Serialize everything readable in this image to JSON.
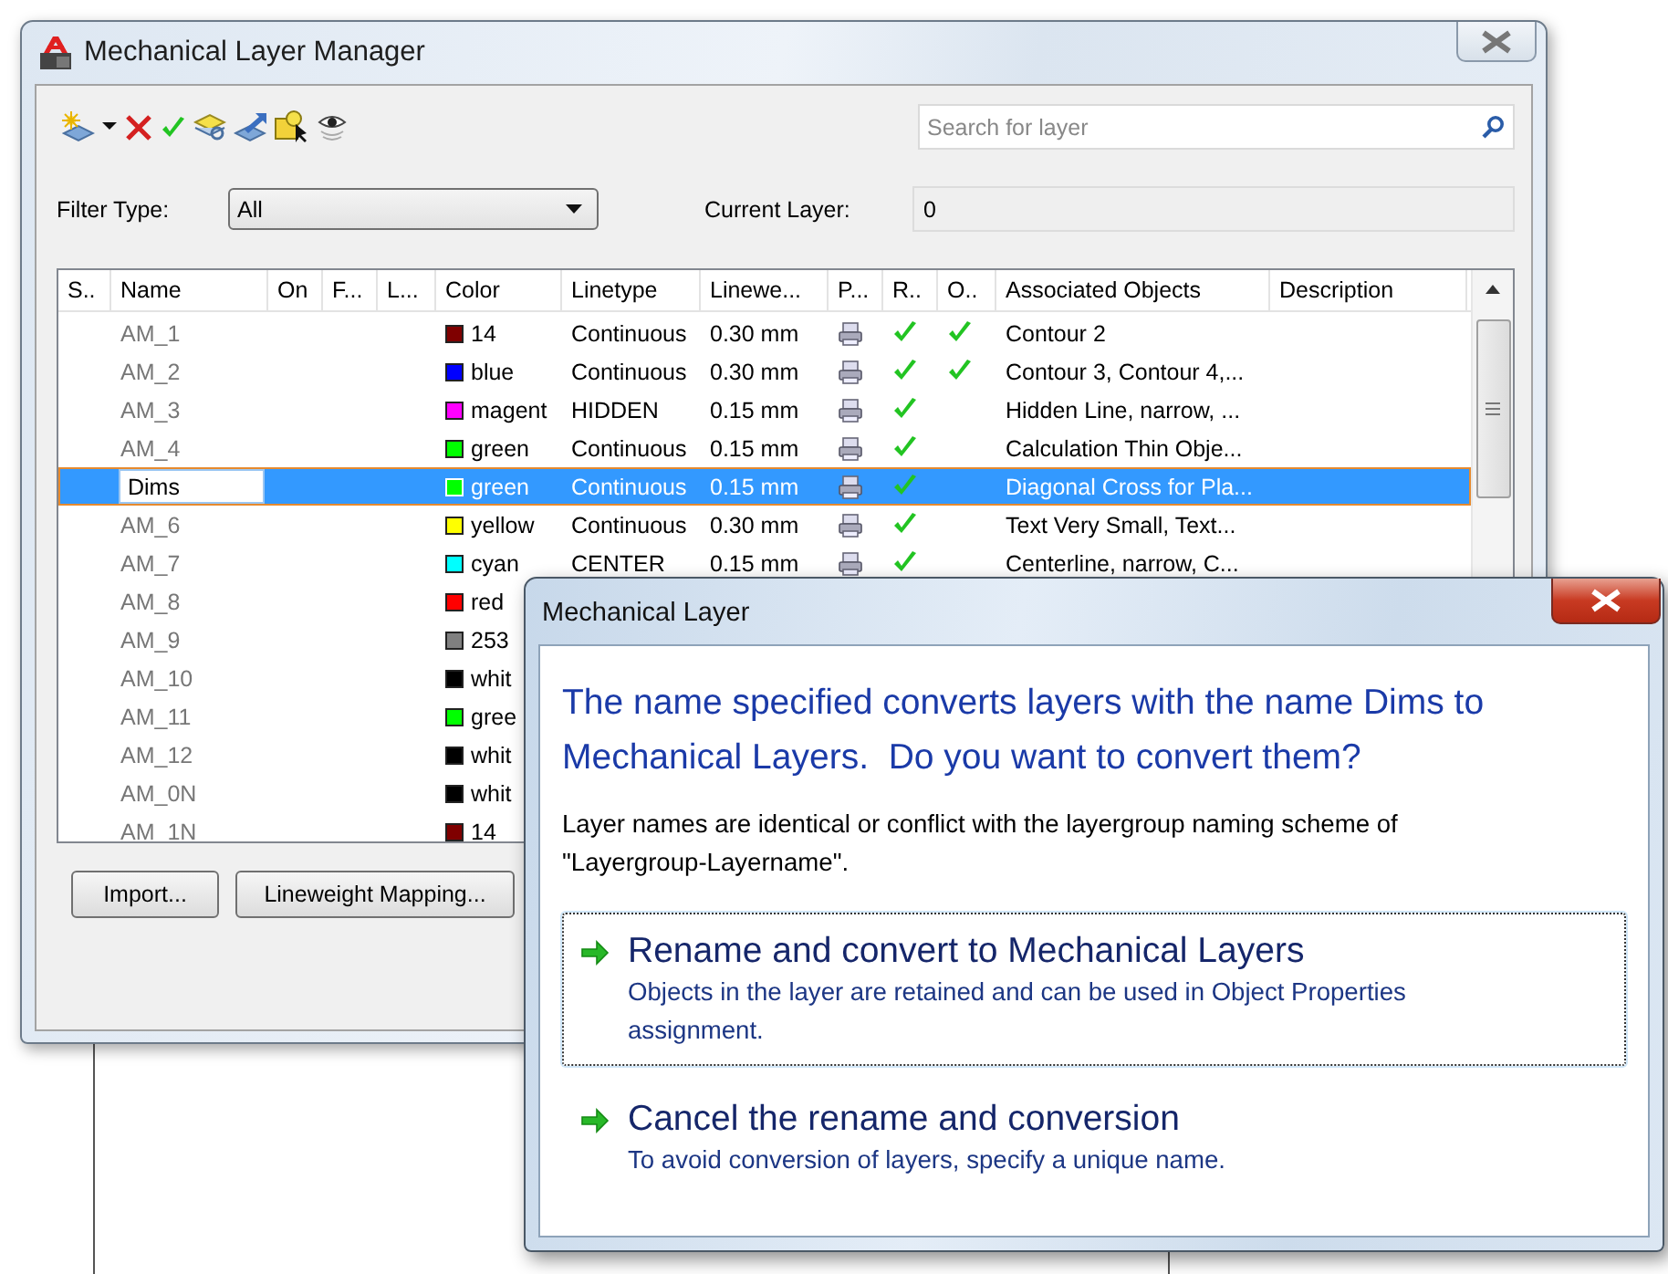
{
  "main_window": {
    "title": "Mechanical Layer Manager",
    "search": {
      "placeholder": "Search for layer"
    },
    "filter_type": {
      "label": "Filter Type:",
      "value": "All"
    },
    "current_layer": {
      "label": "Current Layer:",
      "value": "0"
    },
    "table": {
      "columns": [
        "S..",
        "Name",
        "On",
        "F...",
        "L...",
        "Color",
        "Linetype",
        "Linewe...",
        "P...",
        "R..",
        "O..",
        "Associated Objects",
        "Description"
      ],
      "rows": [
        {
          "name": "AM_1",
          "color": "#7f0000",
          "color_name": "14",
          "linetype": "Continuous",
          "lineweight": "0.30 mm",
          "plot": true,
          "r_check": true,
          "o_check": true,
          "associated": "Contour 2",
          "selected": false,
          "editing": false
        },
        {
          "name": "AM_2",
          "color": "#0000ff",
          "color_name": "blue",
          "linetype": "Continuous",
          "lineweight": "0.30 mm",
          "plot": true,
          "r_check": true,
          "o_check": true,
          "associated": "Contour 3, Contour 4,...",
          "selected": false,
          "editing": false
        },
        {
          "name": "AM_3",
          "color": "#ff00ff",
          "color_name": "magent",
          "linetype": "HIDDEN",
          "lineweight": "0.15 mm",
          "plot": true,
          "r_check": true,
          "o_check": false,
          "associated": "Hidden Line, narrow, ...",
          "selected": false,
          "editing": false
        },
        {
          "name": "AM_4",
          "color": "#00ff00",
          "color_name": "green",
          "linetype": "Continuous",
          "lineweight": "0.15 mm",
          "plot": true,
          "r_check": true,
          "o_check": false,
          "associated": "Calculation Thin Obje...",
          "selected": false,
          "editing": false
        },
        {
          "name": "Dims",
          "color": "#00ff00",
          "color_name": "green",
          "linetype": "Continuous",
          "lineweight": "0.15 mm",
          "plot": true,
          "r_check": true,
          "o_check": false,
          "associated": "Diagonal Cross for Pla...",
          "selected": true,
          "editing": true
        },
        {
          "name": "AM_6",
          "color": "#ffff00",
          "color_name": "yellow",
          "linetype": "Continuous",
          "lineweight": "0.30 mm",
          "plot": true,
          "r_check": true,
          "o_check": false,
          "associated": "Text Very Small, Text...",
          "selected": false,
          "editing": false
        },
        {
          "name": "AM_7",
          "color": "#00ffff",
          "color_name": "cyan",
          "linetype": "CENTER",
          "lineweight": "0.15 mm",
          "plot": true,
          "r_check": true,
          "o_check": false,
          "associated": "Centerline, narrow, C...",
          "selected": false,
          "editing": false
        },
        {
          "name": "AM_8",
          "color": "#ff0000",
          "color_name": "red",
          "selected": false,
          "editing": false
        },
        {
          "name": "AM_9",
          "color": "#808080",
          "color_name": "253",
          "selected": false,
          "editing": false
        },
        {
          "name": "AM_10",
          "color": "#000000",
          "color_name": "whit",
          "selected": false,
          "editing": false
        },
        {
          "name": "AM_11",
          "color": "#00ff00",
          "color_name": "gree",
          "selected": false,
          "editing": false
        },
        {
          "name": "AM_12",
          "color": "#000000",
          "color_name": "whit",
          "selected": false,
          "editing": false
        },
        {
          "name": "AM_0N",
          "color": "#000000",
          "color_name": "whit",
          "selected": false,
          "editing": false
        },
        {
          "name": "AM_1N",
          "color": "#7f0000",
          "color_name": "14",
          "selected": false,
          "editing": false
        }
      ]
    },
    "buttons": [
      "Import...",
      "Lineweight Mapping..."
    ]
  },
  "dialog": {
    "title": "Mechanical Layer",
    "heading": "The name specified converts layers with the name Dims to Mechanical Layers.  Do you want to convert them?",
    "body": "Layer names are identical or conflict with the layergroup naming scheme of \"Layergroup-Layername\".",
    "options": [
      {
        "title": "Rename and convert to Mechanical Layers",
        "description": "Objects in the layer are retained and can be used in Object Properties assignment.",
        "selected": true
      },
      {
        "title": "Cancel the rename and conversion",
        "description": "To avoid conversion of layers, specify a unique name.",
        "selected": false
      }
    ]
  }
}
